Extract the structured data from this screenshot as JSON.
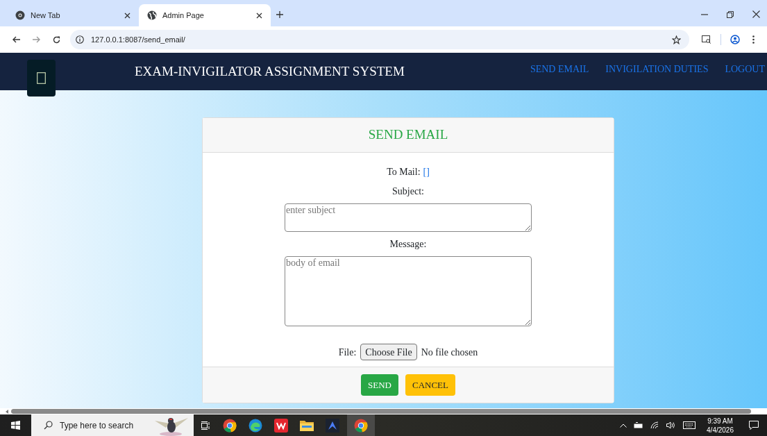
{
  "browser": {
    "tabs": [
      {
        "title": "New Tab",
        "selected": false,
        "kind": "newtab"
      },
      {
        "title": "Admin Page",
        "selected": true,
        "kind": "web"
      }
    ],
    "url": "127.0.0.1:8087/send_email/"
  },
  "navbar": {
    "title": "EXAM-INVIGILATOR ASSIGNMENT SYSTEM",
    "links": [
      "SEND EMAIL",
      "INVIGILATION DUTIES",
      "LOGOUT"
    ]
  },
  "form": {
    "heading": "SEND EMAIL",
    "to_mail_label": "To Mail:",
    "to_mail_value": "[]",
    "subject_label": "Subject:",
    "subject_placeholder": "enter subject",
    "message_label": "Message:",
    "message_placeholder": "body of email",
    "file_label": "File:",
    "file_button": "Choose File",
    "file_status": "No file chosen",
    "buttons": [
      {
        "label": "SEND",
        "kind": "primary"
      },
      {
        "label": "CANCEL",
        "kind": "warning"
      }
    ]
  },
  "taskbar": {
    "search_placeholder": "Type here to search",
    "time": "9:39 AM",
    "date": "4/4/2026"
  }
}
